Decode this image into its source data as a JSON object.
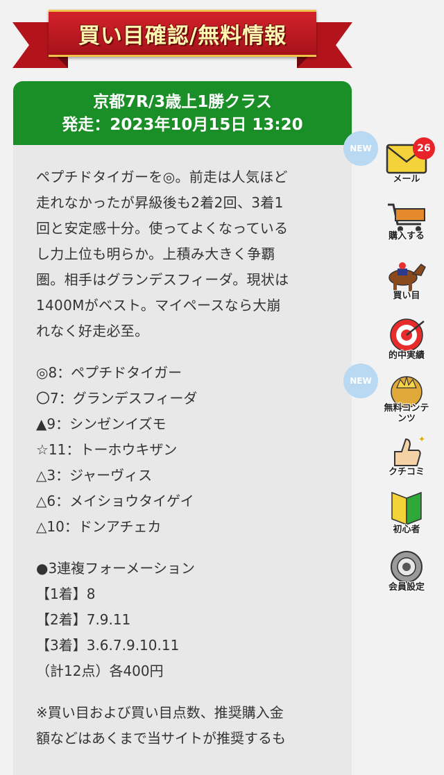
{
  "banner": {
    "title": "買い目確認/無料情報"
  },
  "card": {
    "race": "京都7R/3歳上1勝クラス",
    "start": "発走：2023年10月15日 13:20",
    "comment": [
      "ペプチドタイガーを◎。前走は人気ほど",
      "走れなかったが昇級後も2着2回、3着1",
      "回と安定感十分。使ってよくなっている",
      "し力上位も明らか。上積み大きく争覇",
      "圏。相手はグランデスフィーダ。現状は",
      "1400Mがベスト。マイペースなら大崩",
      "れなく好走必至。"
    ],
    "picks": [
      "◎8：ペプチドタイガー",
      "〇7：グランデスフィーダ",
      "▲9：シンゼンイズモ",
      "☆11：トーホウキザン",
      "△3：ジャーヴィス",
      "△6：メイショウタイゲイ",
      "△10：ドンアチェカ"
    ],
    "bet": [
      "●3連複フォーメーション",
      "【1着】8",
      "【2着】7.9.11",
      "【3着】3.6.7.9.10.11",
      "（計12点）各400円"
    ],
    "note": [
      "※買い目および買い目点数、推奨購入金",
      "額などはあくまで当サイトが推奨するも"
    ]
  },
  "sidebar": {
    "new_label": "NEW",
    "mail_count": "26",
    "items": [
      {
        "label": "メール",
        "icon": "mail-icon"
      },
      {
        "label": "購入する",
        "icon": "cart-icon"
      },
      {
        "label": "買い目",
        "icon": "horse-icon"
      },
      {
        "label": "的中実績",
        "icon": "target-icon"
      },
      {
        "label": "無料コンテンツ",
        "icon": "crown-icon"
      },
      {
        "label": "クチコミ",
        "icon": "thumbs-up-icon"
      },
      {
        "label": "初心者",
        "icon": "beginner-mark-icon"
      },
      {
        "label": "会員設定",
        "icon": "gear-icon"
      }
    ]
  }
}
